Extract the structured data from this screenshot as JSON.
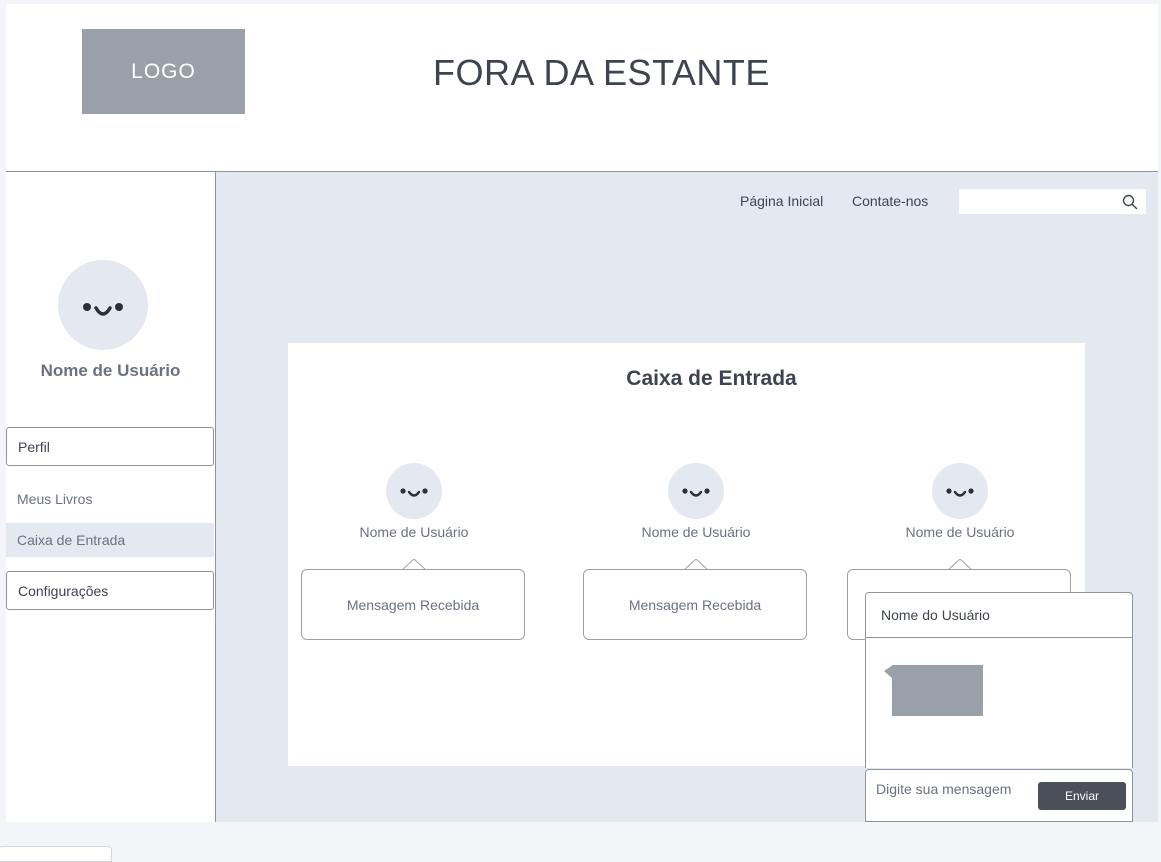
{
  "header": {
    "logo_text": "LOGO",
    "site_title": "FORA DA ESTANTE"
  },
  "sidebar": {
    "username": "Nome de Usuário",
    "items": [
      {
        "label": "Perfil"
      },
      {
        "label": "Meus Livros"
      },
      {
        "label": "Caixa de Entrada"
      },
      {
        "label": "Configurações"
      }
    ]
  },
  "nav": {
    "home": "Página Inicial",
    "contact": "Contate-nos",
    "search_value": "",
    "search_icon": "search-icon"
  },
  "inbox": {
    "title": "Caixa de Entrada",
    "messages": [
      {
        "user": "Nome de Usuário",
        "text": "Mensagem Recebida"
      },
      {
        "user": "Nome de Usuário",
        "text": "Mensagem Recebida"
      },
      {
        "user": "Nome de Usuário",
        "text": ""
      }
    ]
  },
  "chat": {
    "header": "Nome do Usuário",
    "input_placeholder": "Digite sua mensagem",
    "send_label": "Enviar"
  },
  "colors": {
    "accent_dark": "#4a4f5a",
    "placeholder_gray": "#9aa0aa",
    "content_bg": "#e4e8f1"
  }
}
